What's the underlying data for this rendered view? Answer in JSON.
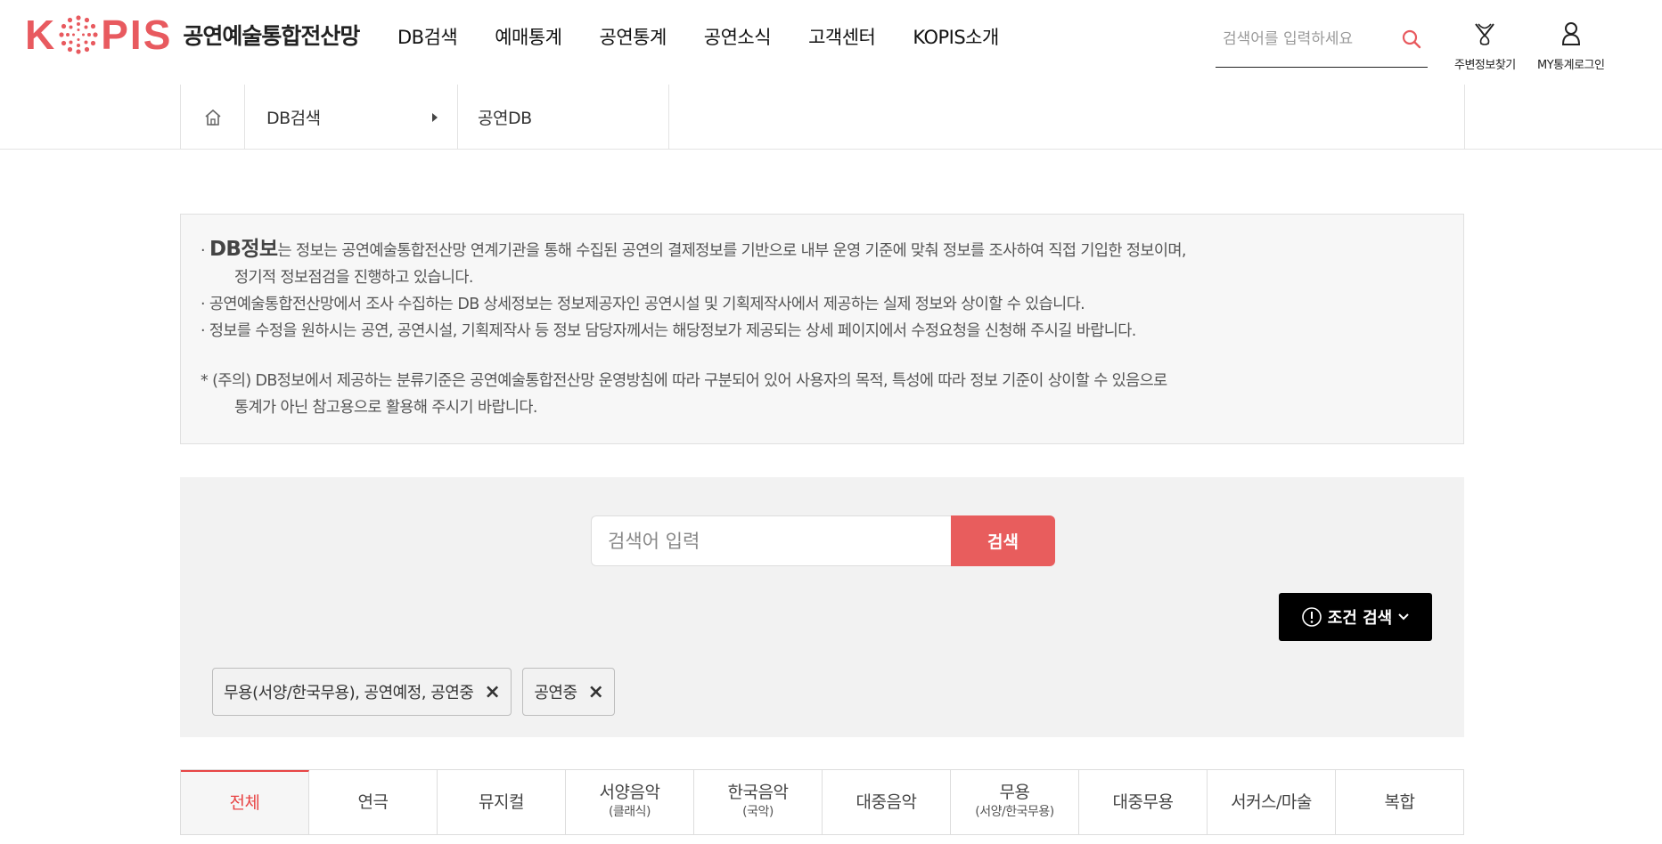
{
  "brand": {
    "logo_letters": [
      "K",
      "P",
      "I",
      "S"
    ],
    "name": "공연예술통합전산망",
    "accent": "#e85a5f"
  },
  "gnb": [
    "DB검색",
    "예매통계",
    "공연통계",
    "공연소식",
    "고객센터",
    "KOPIS소개"
  ],
  "top_search": {
    "placeholder": "검색어를 입력하세요",
    "icon": "search-icon"
  },
  "utils": [
    {
      "label": "주변정보찾기",
      "icon": "map-pin-icon"
    },
    {
      "label": "MY통계로그인",
      "icon": "user-icon"
    }
  ],
  "breadcrumb": {
    "home_icon": "home-icon",
    "level1": "DB검색",
    "level2": "공연DB"
  },
  "notice": {
    "line1_bold": "DB정보",
    "line1_rest": "는 정보는 공연예술통합전산망 연계기관을 통해 수집된 공연의 결제정보를 기반으로 내부 운영 기준에 맞춰 정보를 조사하여 직접 기입한 정보이며,",
    "line1_cont": "정기적 정보점검을 진행하고 있습니다.",
    "line2": "· 공연예술통합전산망에서 조사 수집하는 DB 상세정보는 정보제공자인 공연시설 및 기획제작사에서 제공하는 실제 정보와 상이할 수 있습니다.",
    "line3": "· 정보를 수정을 원하시는 공연, 공연시설, 기획제작사 등 정보 담당자께서는 해당정보가 제공되는 상세 페이지에서 수정요청을 신청해 주시길 바랍니다.",
    "caution": "* (주의) DB정보에서 제공하는 분류기준은 공연예술통합전산망 운영방침에 따라 구분되어 있어 사용자의 목적, 특성에 따라 정보 기준이 상이할 수 있음으로",
    "caution_cont": "통계가 아닌 참고용으로 활용해 주시기 바랍니다."
  },
  "search": {
    "placeholder": "검색어 입력",
    "button": "검색",
    "button_color": "#e85d5d",
    "condition_button": "조건 검색"
  },
  "filters": [
    {
      "label": "무용(서양/한국무용), 공연예정, 공연중",
      "remove": "×"
    },
    {
      "label": "공연중",
      "remove": "×"
    }
  ],
  "tabs": [
    {
      "label": "전체",
      "sub": "",
      "active": true
    },
    {
      "label": "연극",
      "sub": ""
    },
    {
      "label": "뮤지컬",
      "sub": ""
    },
    {
      "label": "서양음악",
      "sub": "(클래식)"
    },
    {
      "label": "한국음악",
      "sub": "(국악)"
    },
    {
      "label": "대중음악",
      "sub": ""
    },
    {
      "label": "무용",
      "sub": "(서양/한국무용)"
    },
    {
      "label": "대중무용",
      "sub": ""
    },
    {
      "label": "서커스/마술",
      "sub": ""
    },
    {
      "label": "복합",
      "sub": ""
    }
  ]
}
